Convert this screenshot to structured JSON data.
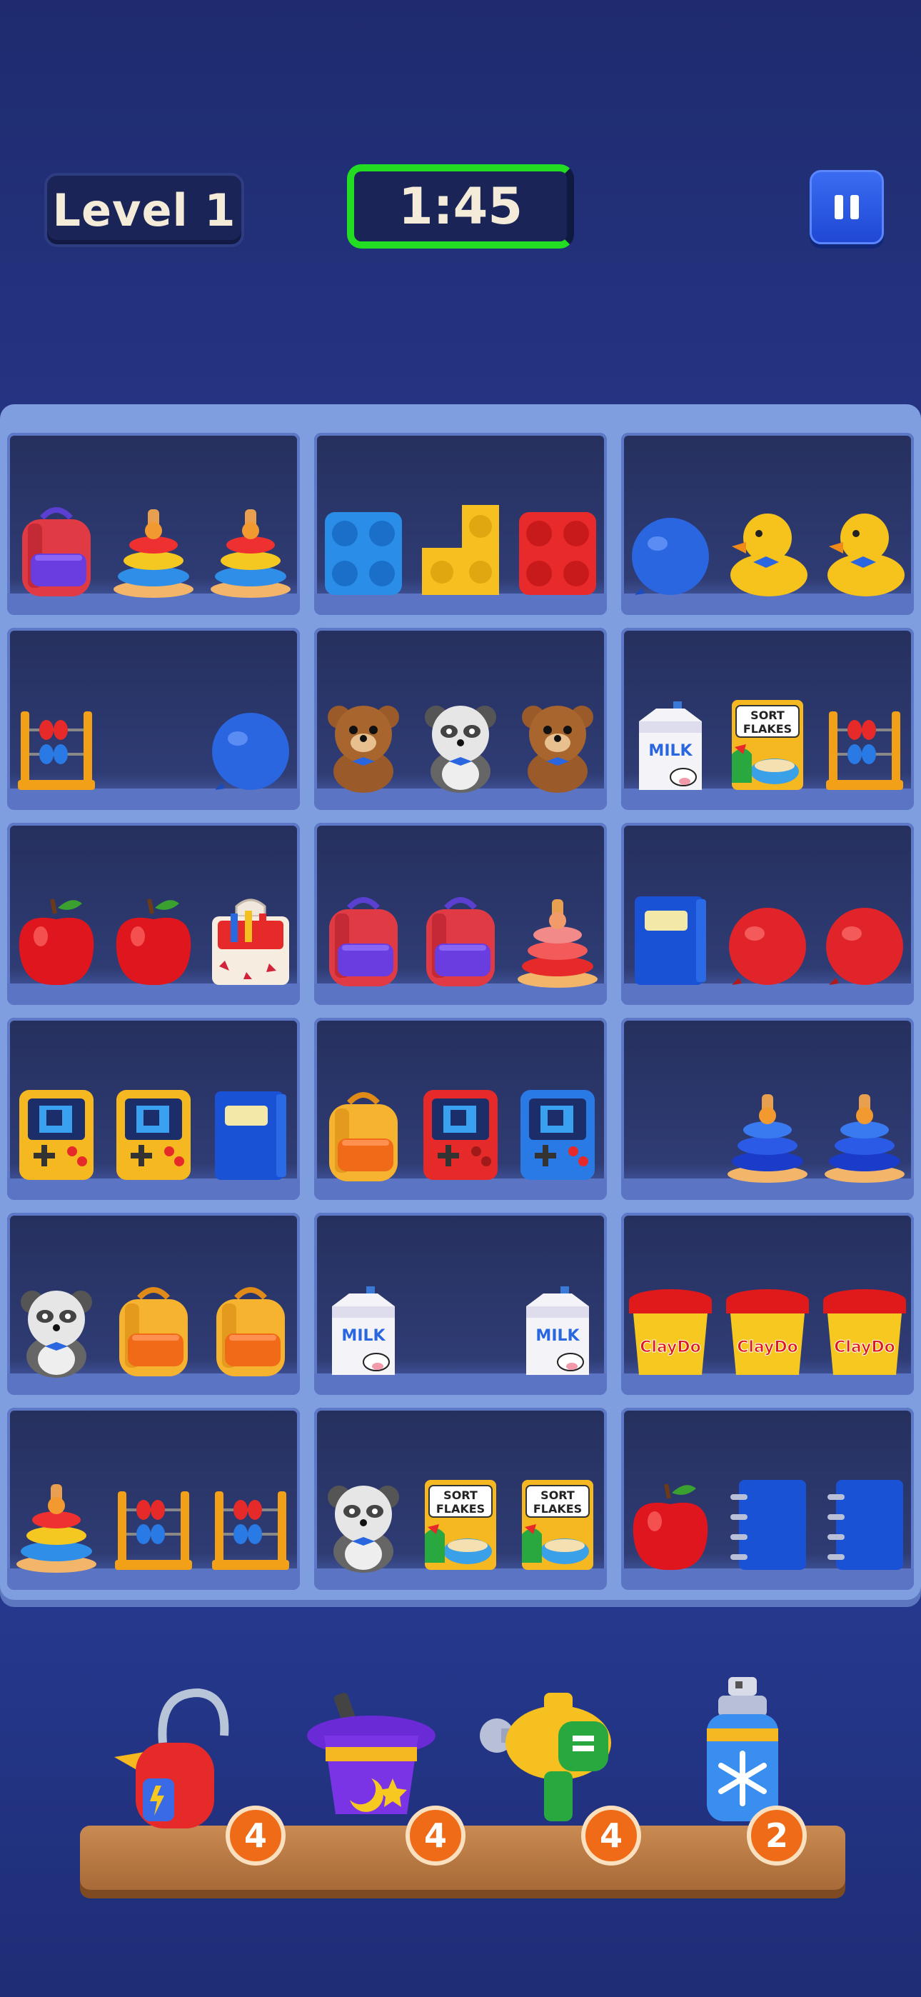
{
  "hud": {
    "level_label": "Level 1",
    "timer": "1:45",
    "timer_progress": 0.6,
    "timer_color": "#22dd22"
  },
  "shelves": [
    {
      "items": [
        "backpack-red",
        "ring-stack-rainbow",
        "ring-stack-rainbow"
      ]
    },
    {
      "items": [
        "block-blue",
        "block-yellow",
        "block-red"
      ]
    },
    {
      "items": [
        "balloon-blue",
        "duck",
        "duck"
      ]
    },
    {
      "items": [
        "abacus",
        "empty",
        "balloon-blue"
      ]
    },
    {
      "items": [
        "teddy-bear",
        "panda-bear",
        "teddy-bear"
      ]
    },
    {
      "items": [
        "milk-carton",
        "cereal-box",
        "abacus"
      ]
    },
    {
      "items": [
        "apple",
        "apple",
        "crayon-box"
      ]
    },
    {
      "items": [
        "backpack-red",
        "backpack-red",
        "ring-stack-pink"
      ]
    },
    {
      "items": [
        "book-blue",
        "balloon-red",
        "balloon-red"
      ]
    },
    {
      "items": [
        "game-console-yellow",
        "game-console-yellow",
        "book-blue"
      ]
    },
    {
      "items": [
        "backpack-yellow",
        "game-console-red",
        "game-console-blue"
      ]
    },
    {
      "items": [
        "empty",
        "ring-stack-blue",
        "ring-stack-blue"
      ]
    },
    {
      "items": [
        "panda-bear",
        "backpack-yellow",
        "backpack-yellow"
      ]
    },
    {
      "items": [
        "milk-carton",
        "empty",
        "milk-carton"
      ]
    },
    {
      "items": [
        "play-dough",
        "play-dough",
        "play-dough"
      ]
    },
    {
      "items": [
        "ring-stack-rainbow",
        "abacus",
        "abacus"
      ]
    },
    {
      "items": [
        "panda-bear",
        "cereal-box",
        "cereal-box"
      ]
    },
    {
      "items": [
        "apple",
        "notebook-blue",
        "notebook-blue"
      ]
    }
  ],
  "text_on_items": {
    "milk": "MILK",
    "cereal_top": "SORT",
    "cereal_bottom": "FLAKES",
    "dough": "ClayDo"
  },
  "boosters": [
    {
      "name": "vacuum",
      "count": "4"
    },
    {
      "name": "magic-hat",
      "count": "4"
    },
    {
      "name": "blaster",
      "count": "4"
    },
    {
      "name": "freeze-spray",
      "count": "2"
    }
  ]
}
